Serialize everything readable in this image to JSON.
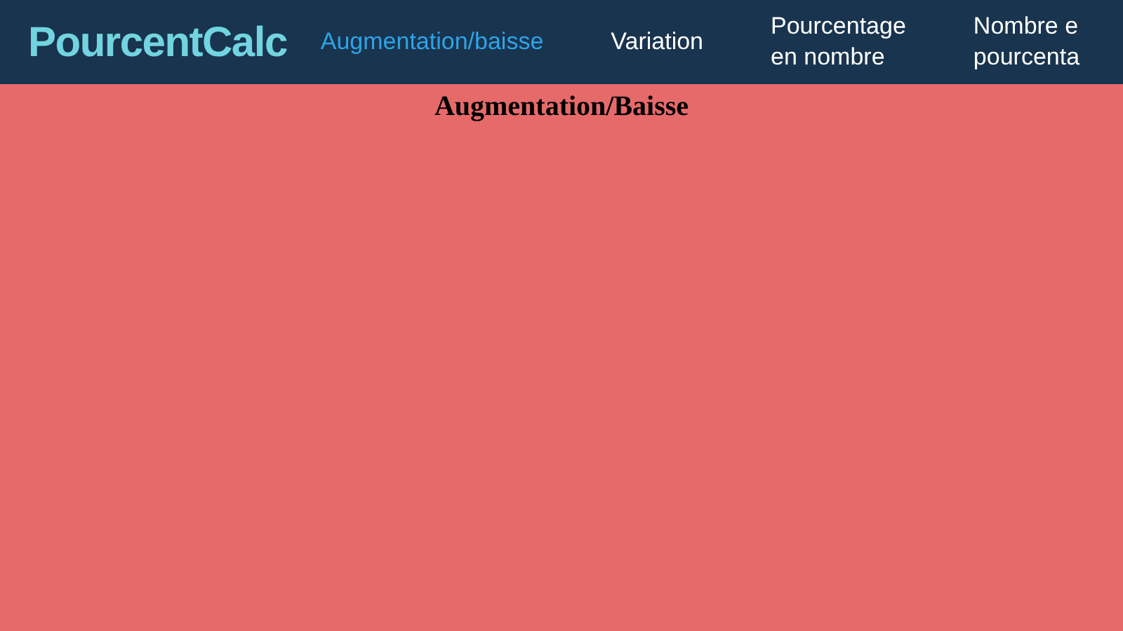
{
  "header": {
    "logo": "PourcentCalc",
    "nav": [
      {
        "lines": [
          "Augmentation/baisse"
        ],
        "selected": true
      },
      {
        "lines": [
          "Variation"
        ],
        "selected": false
      },
      {
        "lines": [
          "Pourcentage",
          "en nombre"
        ],
        "selected": false
      },
      {
        "lines": [
          "Nombre e",
          "pourcenta"
        ],
        "selected": false
      }
    ]
  },
  "page": {
    "title": "Augmentation/Baisse"
  }
}
